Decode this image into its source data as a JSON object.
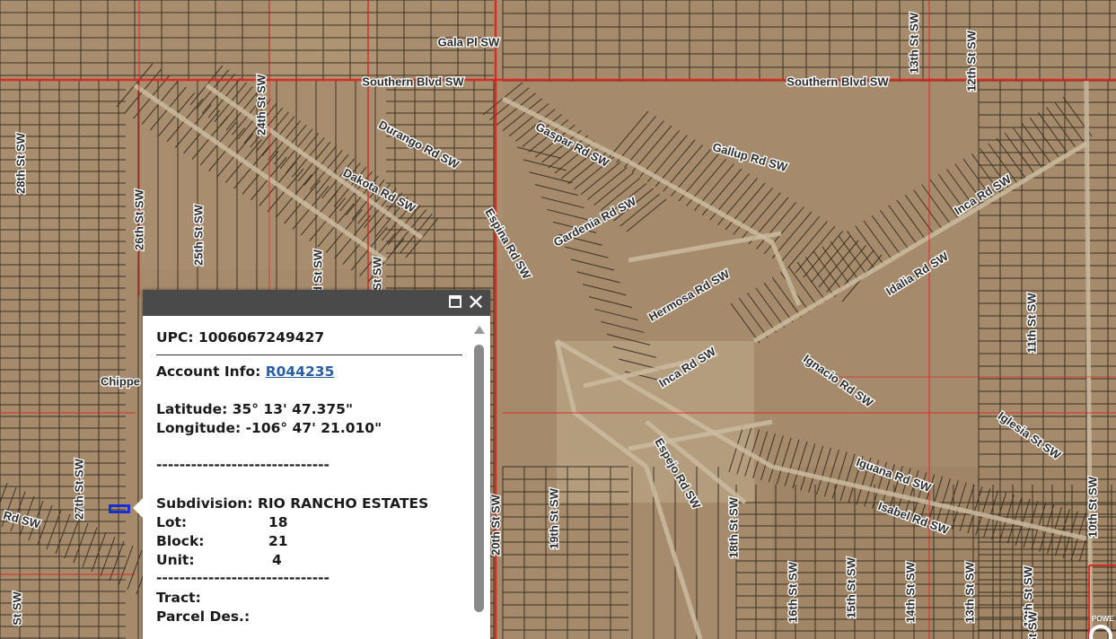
{
  "map": {
    "basemap": "satellite-imagery",
    "colors": {
      "ground": "#a58b6b",
      "parcel_line": "#2a2218",
      "jurisdiction_line": "#e01b1b",
      "dirt_road": "#cbbba0",
      "selected_parcel": "#1530d8"
    },
    "street_labels": [
      {
        "id": "gala-pl",
        "text": "Gala Pl SW"
      },
      {
        "id": "southern-blvd-w",
        "text": "Southern Blvd SW"
      },
      {
        "id": "southern-blvd-e",
        "text": "Southern Blvd SW"
      },
      {
        "id": "13th-st-n",
        "text": "13th St SW"
      },
      {
        "id": "12th-st-n",
        "text": "12th St SW"
      },
      {
        "id": "durango",
        "text": "Durango Rd SW"
      },
      {
        "id": "dakota",
        "text": "Dakota Rd SW"
      },
      {
        "id": "24th-st",
        "text": "24th St SW"
      },
      {
        "id": "28th-st",
        "text": "28th St SW"
      },
      {
        "id": "26th-st",
        "text": "26th St SW"
      },
      {
        "id": "25th-st",
        "text": "25th St SW"
      },
      {
        "id": "rd-st-frag",
        "text": "rd St SW"
      },
      {
        "id": "st-sw-frag",
        "text": "St SW"
      },
      {
        "id": "gaspar",
        "text": "Gaspar Rd SW"
      },
      {
        "id": "gallup",
        "text": "Gallup Rd SW"
      },
      {
        "id": "espina",
        "text": "Espina Rd SW"
      },
      {
        "id": "gardenia",
        "text": "Gardenia Rd SW"
      },
      {
        "id": "inca-ne",
        "text": "Inca Rd SW"
      },
      {
        "id": "idalia",
        "text": "Idalia Rd SW"
      },
      {
        "id": "hermosa",
        "text": "Hermosa Rd SW"
      },
      {
        "id": "inca-c",
        "text": "Inca Rd SW"
      },
      {
        "id": "11th-st",
        "text": "11th St SW"
      },
      {
        "id": "ignacio",
        "text": "Ignacio Rd SW"
      },
      {
        "id": "iglesia",
        "text": "Iglesia St SW"
      },
      {
        "id": "espejo",
        "text": "Espejo Rd SW"
      },
      {
        "id": "iguana",
        "text": "Iguana Rd SW"
      },
      {
        "id": "isabel",
        "text": "Isabel Rd SW"
      },
      {
        "id": "10th-st",
        "text": "10th St SW"
      },
      {
        "id": "20th-st",
        "text": "20th St SW"
      },
      {
        "id": "19th-st",
        "text": "19th St SW"
      },
      {
        "id": "18th-st",
        "text": "18th St SW"
      },
      {
        "id": "16th-st",
        "text": "16th St SW"
      },
      {
        "id": "15th-st",
        "text": "15th St SW"
      },
      {
        "id": "14th-st",
        "text": "14th St SW"
      },
      {
        "id": "13th-st-s",
        "text": "13th St SW"
      },
      {
        "id": "12th-st-s",
        "text": "12th St SW"
      },
      {
        "id": "27th-st",
        "text": "27th St SW"
      },
      {
        "id": "chippe-frag",
        "text": "Chippe"
      },
      {
        "id": "rd-sw-frag",
        "text": "Rd SW"
      },
      {
        "id": "st-sw-bottom",
        "text": "St SW"
      },
      {
        "id": "st-sw-right",
        "text": "St SW"
      }
    ]
  },
  "popup": {
    "upc_label": "UPC:",
    "upc_value": "1006067249427",
    "account_label": "Account Info:",
    "account_value": "R044235",
    "latitude_label": "Latitude:",
    "latitude_value": "35° 13' 47.375\"",
    "longitude_label": "Longitude:",
    "longitude_value": "-106° 47' 21.010\"",
    "divider": "------------------------------",
    "subdivision_label": "Subdivision:",
    "subdivision_value": "RIO RANCHO ESTATES",
    "lot_label": "Lot:",
    "lot_value": "18",
    "block_label": "Block:",
    "block_value": "21",
    "unit_label": "Unit:",
    "unit_value": "4",
    "tract_label": "Tract:",
    "tract_value": "",
    "parcel_des_label": "Parcel Des.:",
    "parcel_des_value": ""
  },
  "attribution": {
    "powered_text": "POWE"
  }
}
